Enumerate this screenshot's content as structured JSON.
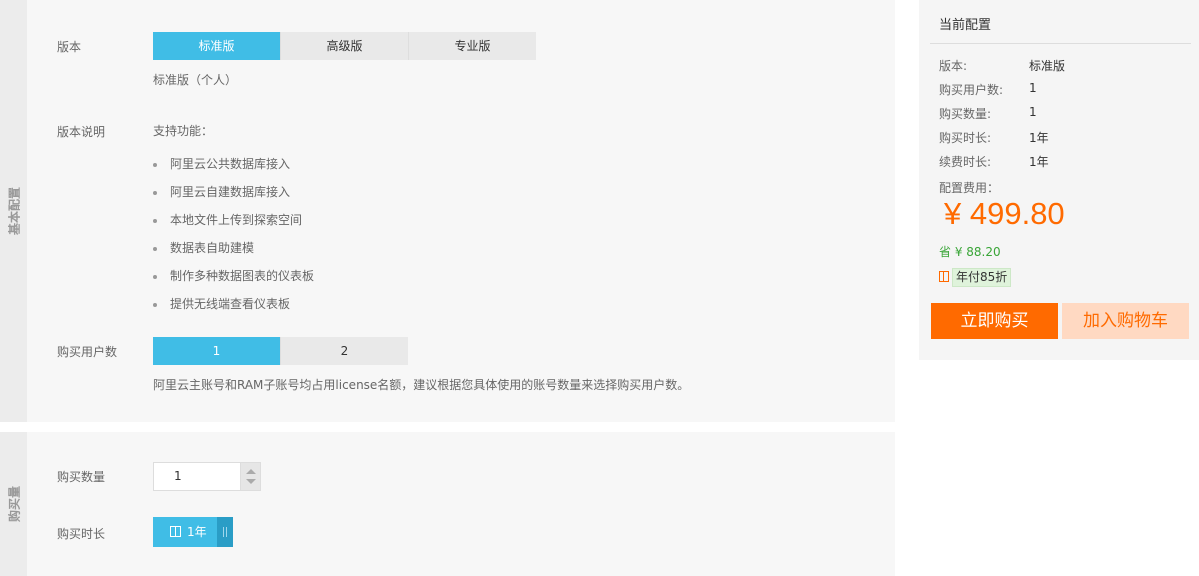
{
  "sections": {
    "basic_tab": "基本配置",
    "quantity_tab": "购买量"
  },
  "edition": {
    "label": "版本",
    "options": [
      "标准版",
      "高级版",
      "专业版"
    ],
    "selected": "标准版",
    "sub_text": "标准版（个人）"
  },
  "description": {
    "label": "版本说明",
    "heading": "支持功能：",
    "features": [
      "阿里云公共数据库接入",
      "阿里云自建数据库接入",
      "本地文件上传到探索空间",
      "数据表自助建模",
      "制作多种数据图表的仪表板",
      "提供无线端查看仪表板"
    ]
  },
  "users": {
    "label": "购买用户数",
    "options": [
      "1",
      "2"
    ],
    "selected": "1",
    "note": "阿里云主账号和RAM子账号均占用license名额，建议根据您具体使用的账号数量来选择购买用户数。"
  },
  "quantity": {
    "label": "购买数量",
    "value": "1"
  },
  "duration": {
    "label": "购买时长",
    "value": "1年"
  },
  "summary": {
    "title": "当前配置",
    "rows": [
      {
        "key": "版本:",
        "value": "标准版"
      },
      {
        "key": "购买用户数:",
        "value": "1"
      },
      {
        "key": "购买数量:",
        "value": "1"
      },
      {
        "key": "购买时长:",
        "value": "1年"
      },
      {
        "key": "续费时长:",
        "value": "1年"
      }
    ],
    "fee_label": "配置费用：",
    "price": "¥ 499.80",
    "saving": "省 ¥ 88.20",
    "promo": "年付85折",
    "buy_label": "立即购买",
    "cart_label": "加入购物车"
  },
  "colors": {
    "accent": "#40bde6",
    "price": "#ff6a00",
    "saving": "#39a537"
  }
}
